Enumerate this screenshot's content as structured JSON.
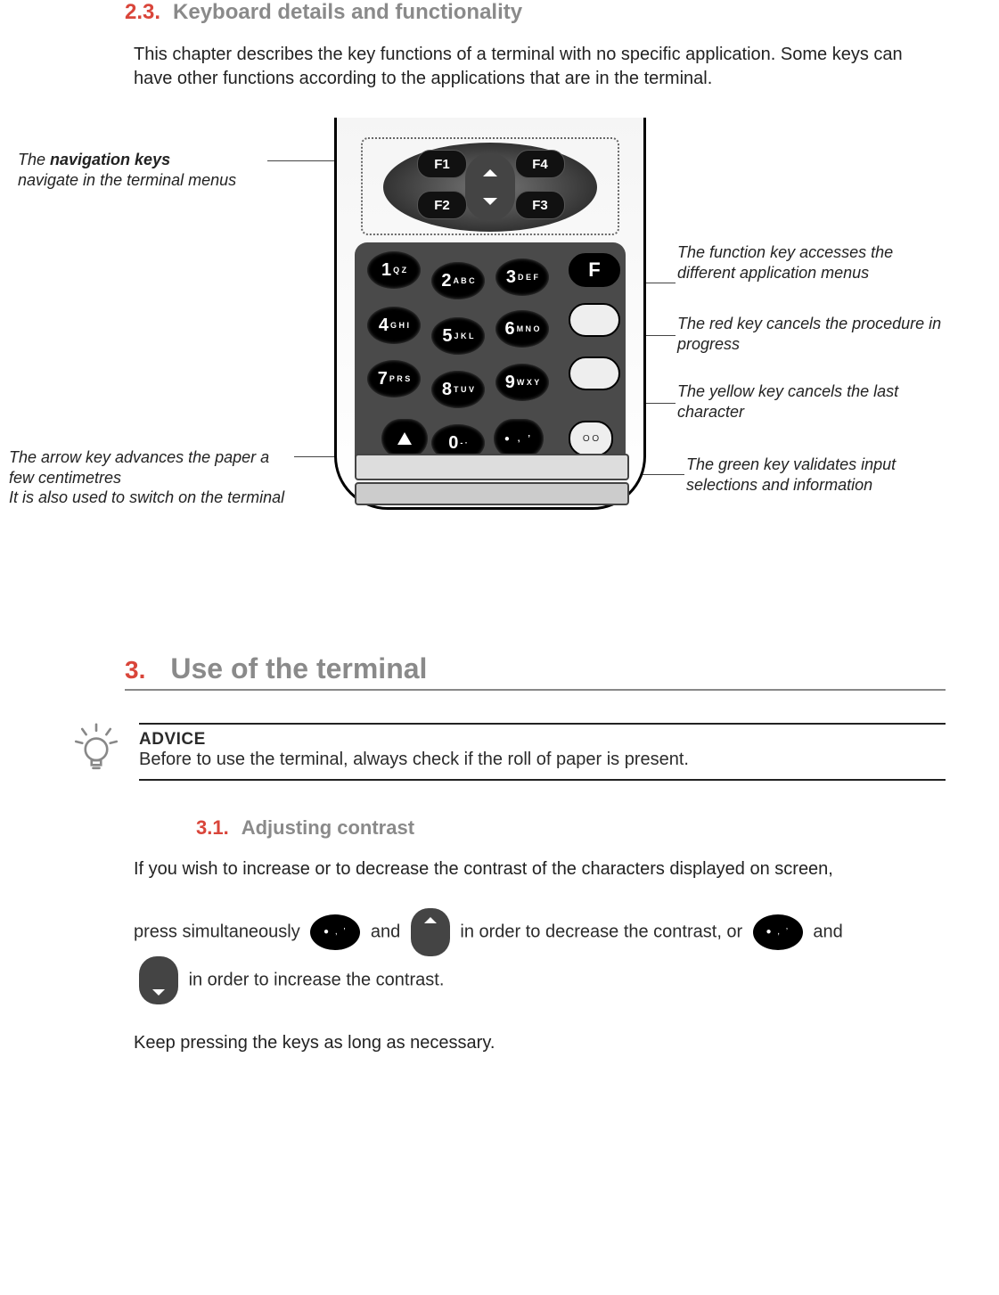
{
  "section23": {
    "num": "2.3.",
    "title": "Keyboard details and functionality",
    "intro": "This chapter describes the key functions of a terminal with no specific application. Some keys can have other functions according to the applications that are in the terminal."
  },
  "callouts": {
    "nav_line1_prefix": "The ",
    "nav_line1_bold": "navigation keys",
    "nav_line2": "navigate in the terminal menus",
    "func": "The function key accesses the different application menus",
    "red": "The red key cancels the procedure in progress",
    "yellow": "The yellow key cancels the last character",
    "green": "The green key validates input selections and information",
    "arrow_line1": "The arrow key advances the paper a few centimetres",
    "arrow_line2": "It is also used to switch on the terminal"
  },
  "keys": {
    "f1": "F1",
    "f2": "F2",
    "f3": "F3",
    "f4": "F4",
    "k1_main": "1",
    "k1_sub": "Q Z",
    "k2_main": "2",
    "k2_sub": "A B C",
    "k3_main": "3",
    "k3_sub": "D E F",
    "k4_main": "4",
    "k4_sub": "G H I",
    "k5_main": "5",
    "k5_sub": "J K L",
    "k6_main": "6",
    "k6_sub": "M N O",
    "k7_main": "7",
    "k7_sub": "P R S",
    "k8_main": "8",
    "k8_sub": "T U V",
    "k9_main": "9",
    "k9_sub": "W X Y",
    "k0_main": "0",
    "k0_sub": "- ·",
    "fkey": "F",
    "green_label": "O O"
  },
  "chapter3": {
    "num": "3.",
    "title": "Use of the terminal"
  },
  "advice": {
    "title": "ADVICE",
    "text": "Before to use the terminal, always check if the roll of paper is present."
  },
  "section31": {
    "num": "3.1.",
    "title": "Adjusting contrast",
    "p1": "If you wish to increase or to decrease the contrast of the characters displayed on screen,",
    "p2a": "press simultaneously ",
    "p2b": " and",
    "p2c": " in order to decrease the contrast, or ",
    "p2d": " and",
    "p3": " in order to increase the contrast.",
    "p4": "Keep pressing the keys as long as necessary."
  }
}
